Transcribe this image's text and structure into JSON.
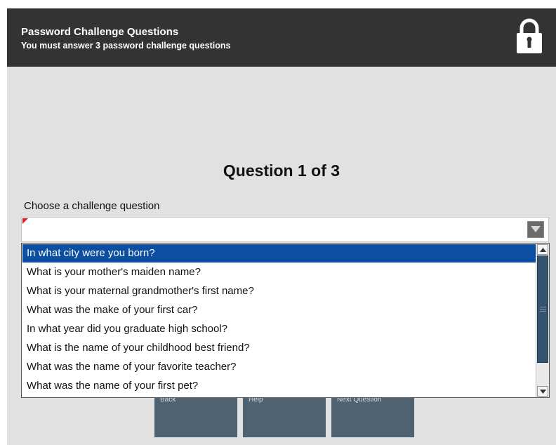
{
  "header": {
    "title": "Password Challenge Questions",
    "subtitle": "You must answer 3 password challenge questions",
    "icon": "lock-icon"
  },
  "main": {
    "question_heading": "Question 1 of 3",
    "field_label": "Choose a challenge question",
    "select": {
      "value": "",
      "required": true
    },
    "dropdown": {
      "options": [
        "In what city were you born?",
        "What is your mother's maiden name?",
        "What is your maternal grandmother's first name?",
        "What was the make of your first car?",
        "In what year did you graduate high school?",
        "What is the name of your childhood best friend?",
        "What was the name of your favorite teacher?",
        "What was the name of your first pet?"
      ],
      "selected_index": 0
    }
  },
  "buttons": {
    "back": "Back",
    "help": "Help",
    "next": "Next Question"
  },
  "colors": {
    "header_bg": "#333333",
    "page_bg": "#e1e1e1",
    "selected_option": "#0b4ea2",
    "button_bg": "#4f6272",
    "scroll_thumb": "#34536f"
  }
}
